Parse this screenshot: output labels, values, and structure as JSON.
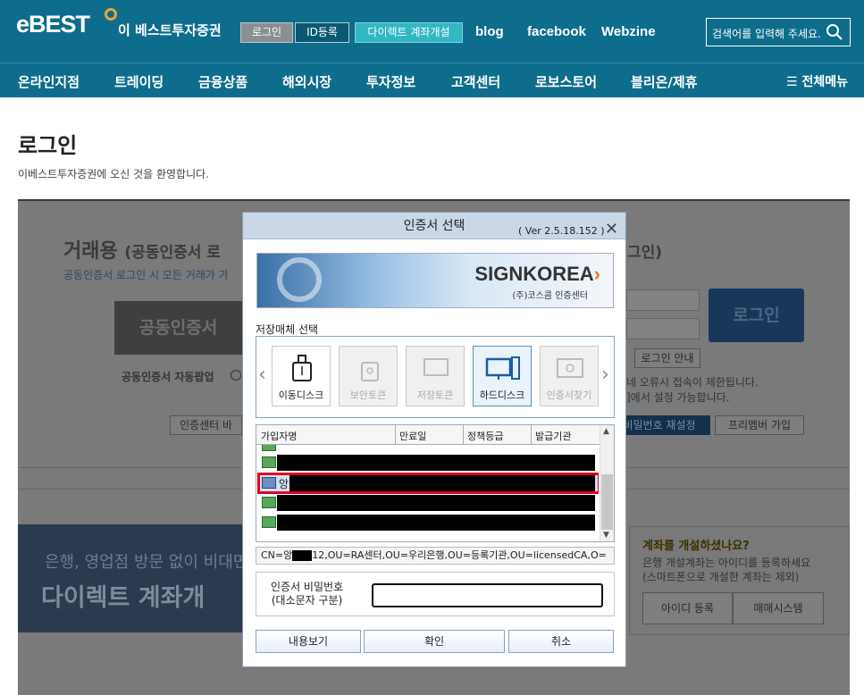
{
  "header": {
    "logo": "eBEST",
    "brand": "이 베스트투자증권",
    "login": "로그인",
    "register": "ID등록",
    "direct_account": "다이렉트 계좌개설",
    "blog": "blog",
    "facebook": "facebook",
    "webzine": "Webzine",
    "search_placeholder": "검색어를 입력해 주세요."
  },
  "nav": {
    "items": [
      "온라인지점",
      "트레이딩",
      "금융상품",
      "해외시장",
      "투자정보",
      "고객센터",
      "로보스토어",
      "블리온/제휴"
    ],
    "all_menu": "전체메뉴"
  },
  "page": {
    "title": "로그인",
    "subtitle": "이베스트투자증권에 오신 것을 환영합니다."
  },
  "background": {
    "trade_title": "거래용",
    "trade_sub": "(공동인증서 로",
    "trade_desc": "공동인증서 로그인 시 모든 거래가 가",
    "cert_login_btn": "공동인증서",
    "auto_popup": "공동인증서 자동팝업",
    "cert_center": "인증센터 바",
    "right_title_end": "그인)",
    "login_btn": "로그인",
    "login_guide": "로그인 안내",
    "warn1": "네 오류시 접속이 제한됩니다.",
    "warn2": "]에서 설정 가능합니다.",
    "pw_reset": "비밀번호 재설정",
    "free_member": "프리멤버 가입",
    "banner1": "은행, 영업점 방문 없이 비대면",
    "banner2": "다이렉트 계좌개",
    "open_q": "계좌를 개설하셨나요?",
    "open_d1": "은행 개설계좌는 아이디를 등록하세요",
    "open_d2": "(스마트폰으로 개설한 계좌는 제외)",
    "id_register": "아이디 등록",
    "trading_system": "매매시스템"
  },
  "dialog": {
    "title": "인증서 선택",
    "version": "( Ver 2.5.18.152 )",
    "signkorea": "SIGNKOREA",
    "signkorea_sub": "(주)코스콤 인증센터",
    "media_label": "저장매체 선택",
    "media": [
      {
        "label": "이동디스크",
        "state": "normal"
      },
      {
        "label": "보안토큰",
        "state": "disabled"
      },
      {
        "label": "저장토큰",
        "state": "disabled"
      },
      {
        "label": "하드디스크",
        "state": "selected"
      },
      {
        "label": "인증서찾기",
        "state": "disabled"
      }
    ],
    "columns": [
      "가입자명",
      "만료일",
      "정책등급",
      "발급기관"
    ],
    "selected_row_prefix": "앙",
    "cn_prefix": "CN=앙",
    "cn_suffix": "12,OU=RA센터,OU=우리은행,OU=등록기관,OU=licensedCA,O=",
    "pw_label1": "인증서 비밀번호",
    "pw_label2": "(대소문자 구분)",
    "btn_view": "내용보기",
    "btn_ok": "확인",
    "btn_cancel": "취소"
  }
}
